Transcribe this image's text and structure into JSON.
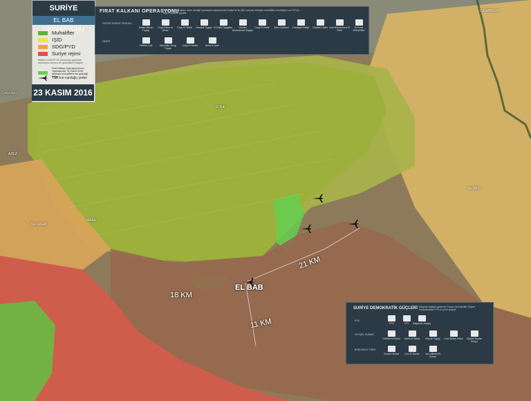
{
  "header": {
    "title": "SURİYE GÜNDEMİ",
    "subtitle": "EL BAB OPERASYONU",
    "date": "23 KASIM 2016"
  },
  "legend": {
    "items": [
      {
        "label": "Muhalifler",
        "color": "#5fb04a"
      },
      {
        "label": "IŞİD",
        "color": "#f2e24a"
      },
      {
        "label": "SDG/PYD",
        "color": "#f0a53a"
      },
      {
        "label": "Suriye rejimi",
        "color": "#e05050"
      }
    ],
    "note_text": "Beltan'ın SDG/PYD unsurunun yaptıkları operasyon sonucu ele geçirdikleri bölgeler",
    "progress_label": "Fırat Kalkanı Operasyonu'nun 'Aşamasında' 31 Kasım 2016 tarihinde muhaliflerin ele geçirdiği bölge",
    "airstrike_label": "TSK'nın vurduğu yerler"
  },
  "top_panel": {
    "title": "FIRAT KALKANI OPERASYONU",
    "description": "TSK'nın Fırat Kalkanı adını verdiği Operasyon kapsamında Suriye'de ilk IŞİD sonrası ilerleyen muhalifleri destekliyor ve PYD'ye karşı harekete geçildi.",
    "row1_label": "ÖZGÜR SURİYE ORDUSU",
    "row2_label": "DİĞER",
    "row1_groups": [
      "Sultan Murad Tugayı",
      "Ceyş Sukur el Şimal",
      "Ceyş El Tahrir",
      "Hamzat Tugayı",
      "El Nahr Tugayları",
      "Ümmet Muhammed Tugayı",
      "Ceyş El Neffir",
      "Şam Cephesi",
      "Fastaqim Birliği",
      "Feylaku'l Şam",
      "Liva Muhammed El Fatih",
      "El Furat Mücahitleri"
    ],
    "row2_groups": [
      "Fetihler Dalı",
      "Nureddin Zengi Tugayı",
      "Ceyş El Selam",
      "Ahrar el Şam"
    ]
  },
  "bottom_panel": {
    "title": "SURİYE DEMOKRATİK GÜÇLERİ",
    "description": "Bölgede faaliyet gösteren Suriye Demokratik Güçleri bünyesindeki PYD ve yerel gruplar",
    "row1_label": "PYD",
    "row2_label": "CEYŞÜL SUWAR",
    "row3_label": "BURKAN EL FIRAT",
    "row1_groups": [
      "YPG",
      "YPJ",
      "Bagımsız Asayiş"
    ],
    "row2_groups": [
      "Cebhet el Ekrad",
      "Şems el Şimal",
      "Selçuk Tugayı",
      "Liva Sultan Selim",
      "Siyahe Suwar Suriye"
    ],
    "row3_groups": [
      "Ceyş'ül Suwar",
      "Liva El Suwar",
      "Liva Ülkeret El Suwar"
    ]
  },
  "map_labels": {
    "cerablus": "CERABLUS",
    "cobanbey": "Çobanbey",
    "azez": "AZEZ",
    "telrifat": "TEL RIFAT",
    "marea": "MARE",
    "elbab": "EL BAB",
    "menbic": "MENBİÇ",
    "elrai": "El Rai"
  },
  "distances": {
    "west": "18 KM",
    "east": "21 KM",
    "south": "11 KM"
  }
}
